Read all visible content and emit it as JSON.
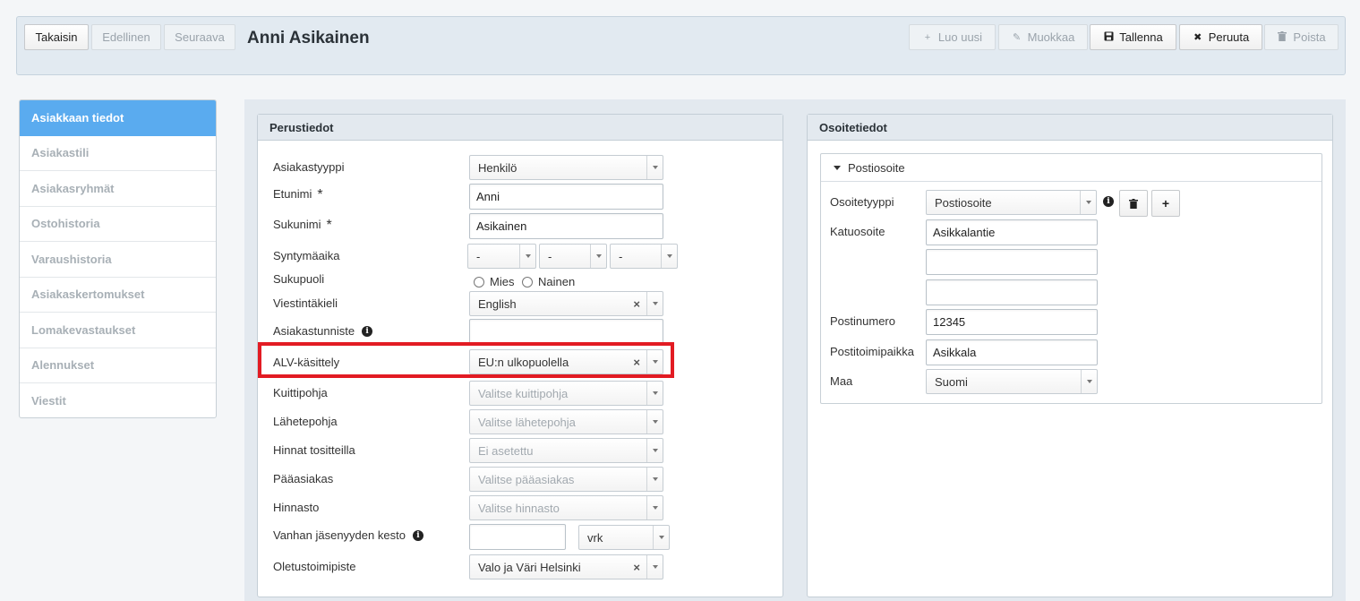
{
  "toolbar": {
    "back": "Takaisin",
    "previous": "Edellinen",
    "next": "Seuraava",
    "title": "Anni Asikainen",
    "new": "Luo uusi",
    "edit": "Muokkaa",
    "save": "Tallenna",
    "cancel": "Peruuta",
    "delete": "Poista"
  },
  "sidebar": {
    "items": [
      {
        "label": "Asiakkaan tiedot",
        "active": true
      },
      {
        "label": "Asiakastili"
      },
      {
        "label": "Asiakasryhmät"
      },
      {
        "label": "Ostohistoria"
      },
      {
        "label": "Varaushistoria"
      },
      {
        "label": "Asiakaskertomukset"
      },
      {
        "label": "Lomakevastaukset"
      },
      {
        "label": "Alennukset"
      },
      {
        "label": "Viestit"
      }
    ]
  },
  "basic": {
    "header": "Perustiedot",
    "customer_type_label": "Asiakastyyppi",
    "customer_type_value": "Henkilö",
    "first_name_label": "Etunimi",
    "first_name_value": "Anni",
    "last_name_label": "Sukunimi",
    "last_name_value": "Asikainen",
    "required_mark": "*",
    "birth_label": "Syntymäaika",
    "birth_day": "-",
    "birth_month": "-",
    "birth_year": "-",
    "gender_label": "Sukupuoli",
    "gender_male": "Mies",
    "gender_female": "Nainen",
    "language_label": "Viestintäkieli",
    "language_value": "English",
    "identifier_label": "Asiakastunniste",
    "identifier_value": "",
    "vat_label": "ALV-käsittely",
    "vat_value": "EU:n ulkopuolella",
    "receipt_label": "Kuittipohja",
    "receipt_placeholder": "Valitse kuittipohja",
    "delivery_label": "Lähetepohja",
    "delivery_placeholder": "Valitse lähetepohja",
    "prices_label": "Hinnat tositteilla",
    "prices_value": "Ei asetettu",
    "main_customer_label": "Pääasiakas",
    "main_customer_placeholder": "Valitse pääasiakas",
    "pricelist_label": "Hinnasto",
    "pricelist_placeholder": "Valitse hinnasto",
    "membership_label": "Vanhan jäsenyyden kesto",
    "membership_value": "",
    "membership_unit": "vrk",
    "office_label": "Oletustoimipiste",
    "office_value": "Valo ja Väri Helsinki",
    "clear_mark": "×",
    "info_mark": "i"
  },
  "address": {
    "header": "Osoitetiedot",
    "section_title": "Postiosoite",
    "type_label": "Osoitetyyppi",
    "type_value": "Postiosoite",
    "street_label": "Katuosoite",
    "street_line1": "Asikkalantie",
    "street_line2": "",
    "street_line3": "",
    "postal_code_label": "Postinumero",
    "postal_code_value": "12345",
    "city_label": "Postitoimipaikka",
    "city_value": "Asikkala",
    "country_label": "Maa",
    "country_value": "Suomi"
  },
  "colors": {
    "accent": "#5aabef",
    "highlight": "#e21b23"
  }
}
